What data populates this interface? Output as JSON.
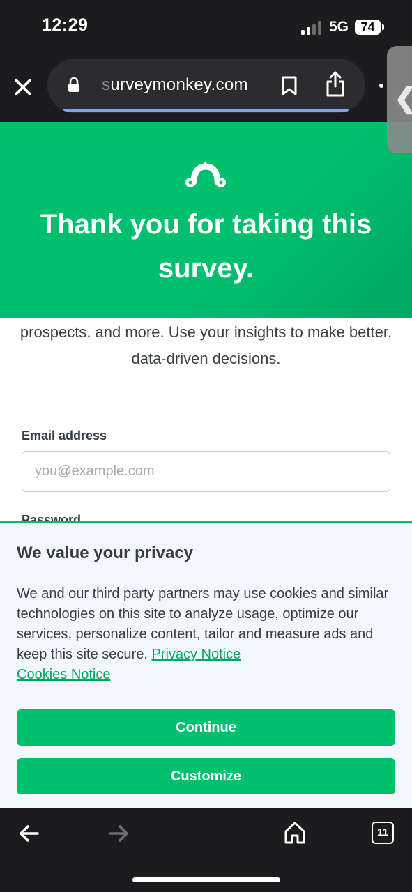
{
  "status_bar": {
    "time": "12:29",
    "network": "5G",
    "battery": "74"
  },
  "browser": {
    "url_faded": "s",
    "url_main": "urveymonkey.com",
    "icons": [
      "close-icon",
      "lock-icon",
      "bookmark-icon",
      "share-icon",
      "more-icon",
      "chevron-left-icon"
    ]
  },
  "hero": {
    "title": "Thank you for taking this survey."
  },
  "page": {
    "intro_text": "prospects, and more. Use your insights to make better, data-driven decisions.",
    "email_label": "Email address",
    "email_placeholder": "you@example.com",
    "password_label": "Password"
  },
  "privacy": {
    "title": "We value your privacy",
    "body": "We and our third party partners may use cookies and similar technologies on this site to analyze usage, optimize our services, personalize content, tailor and measure ads and keep this site secure. ",
    "privacy_notice_link": "Privacy Notice",
    "cookies_notice_link": "Cookies Notice",
    "continue_label": "Continue",
    "customize_label": "Customize"
  },
  "toolbar": {
    "tab_count": "11",
    "icons": [
      "back-arrow-icon",
      "forward-arrow-icon",
      "home-icon",
      "tabs-icon"
    ]
  },
  "colors": {
    "brand_green": "#00bf6f",
    "link_green": "#00a862",
    "text_dark": "#333e48",
    "banner_bg": "#f2f7fb",
    "chrome_dark": "#1c1c1e"
  }
}
